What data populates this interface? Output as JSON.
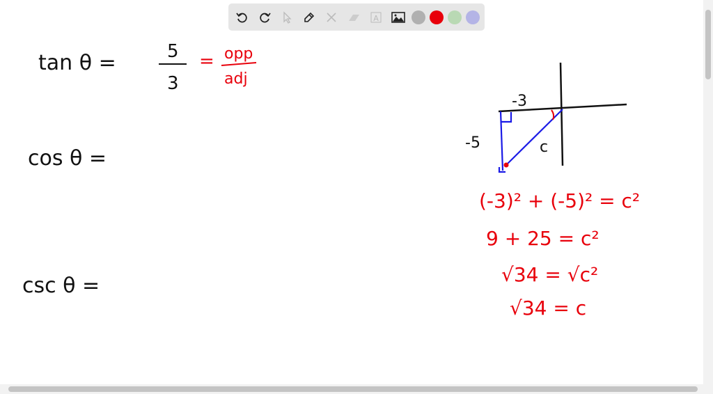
{
  "toolbar": {
    "tools": [
      "undo-icon",
      "redo-icon",
      "select-icon",
      "pen-icon",
      "tools-icon",
      "eraser-icon",
      "text-icon",
      "image-icon"
    ],
    "colors": [
      "#b0b0b0",
      "#e8000b",
      "#b9d9b4",
      "#b4b4e6"
    ]
  },
  "board": {
    "tan_lhs": "tan θ =",
    "tan_num": "5",
    "tan_den": "3",
    "eq": "=",
    "opp": "opp",
    "adj": "adj",
    "cos_line": "cos θ =",
    "csc_line": "csc θ =",
    "label_x": "-3",
    "label_y": "-5",
    "label_hyp": "c",
    "step1": "(-3)² + (-5)² = c²",
    "step2": "9 + 25 = c²",
    "step3": "√34 = √c²",
    "step4": "√34 = c"
  },
  "colors": {
    "ink": "#111111",
    "red": "#e8000b",
    "blue": "#1a1ae6"
  }
}
